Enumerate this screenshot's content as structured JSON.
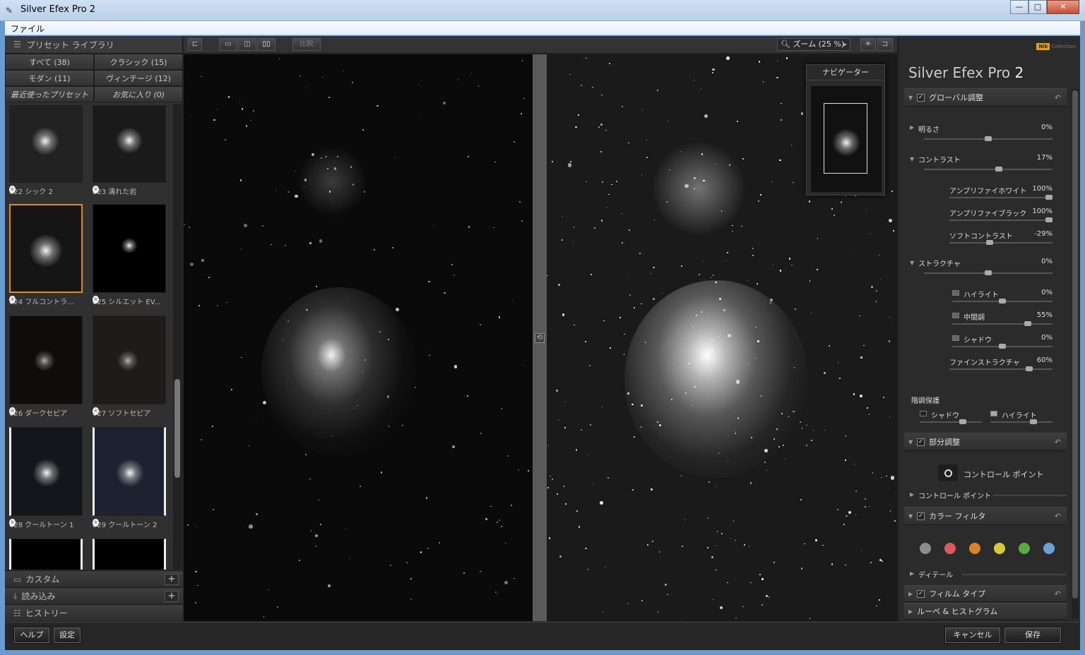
{
  "window": {
    "title": "Silver Efex Pro 2",
    "controls": [
      "minimize-icon",
      "maximize-icon",
      "close-icon"
    ]
  },
  "menu": {
    "file": "ファイル"
  },
  "left_panel": {
    "header": "プリセット ライブラリ",
    "tabs": [
      "すべて (38)",
      "クラシック (15)",
      "モダン (11)",
      "ヴィンテージ (12)",
      "最近使ったプリセット",
      "お気に入り (0)"
    ],
    "presets": [
      {
        "label": "022 シック 2"
      },
      {
        "label": "023 濡れた岩"
      },
      {
        "label": "024 フルコントラ..."
      },
      {
        "label": "025 シルエット EV..."
      },
      {
        "label": "026 ダークセピア"
      },
      {
        "label": "027 ソフトセピア"
      },
      {
        "label": "028 クールトーン 1"
      },
      {
        "label": "029 クールトーン 2"
      }
    ],
    "sections": [
      "カスタム",
      "読み込み",
      "ヒストリー"
    ]
  },
  "toolbar": {
    "compare": "比較",
    "zoom": "ズーム (25 %)"
  },
  "navigator": {
    "title": "ナビゲーター"
  },
  "right_panel": {
    "logo": "Collection",
    "logo_badge": "Nik",
    "app_title": "Silver Efex Pro",
    "app_version": "2",
    "global": {
      "title": "グローバル調整",
      "brightness": {
        "label": "明るさ",
        "value": "0%"
      },
      "contrast": {
        "label": "コントラスト",
        "value": "17%"
      },
      "amplify_white": {
        "label": "アンプリファイホワイト",
        "value": "100%"
      },
      "amplify_black": {
        "label": "アンプリファイブラック",
        "value": "100%"
      },
      "soft_contrast": {
        "label": "ソフトコントラスト",
        "value": "-29%"
      },
      "structure": {
        "label": "ストラクチャ",
        "value": "0%"
      },
      "highlight": {
        "label": "ハイライト",
        "value": "0%"
      },
      "midtone": {
        "label": "中間調",
        "value": "55%"
      },
      "shadow": {
        "label": "シャドウ",
        "value": "0%"
      },
      "fine_structure": {
        "label": "ファインストラクチャ",
        "value": "60%"
      },
      "tonal_protection": "階調保護",
      "tp_shadow": "シャドウ",
      "tp_highlight": "ハイライト"
    },
    "selective": {
      "title": "部分調整",
      "control_point_btn": "コントロール ポイント",
      "control_point_row": "コントロール ポイント"
    },
    "color_filter": {
      "title": "カラー フィルタ",
      "colors": [
        "#8c8c8c",
        "#d85a5a",
        "#d8842e",
        "#d8c838",
        "#5aaa44",
        "#6aa0d8"
      ],
      "detail": "ディテール"
    },
    "film_type": {
      "title": "フィルム タイプ"
    },
    "loupe": {
      "title": "ルーペ & ヒストグラム"
    }
  },
  "bottom": {
    "help": "ヘルプ",
    "settings": "設定",
    "cancel": "キャンセル",
    "save": "保存"
  }
}
